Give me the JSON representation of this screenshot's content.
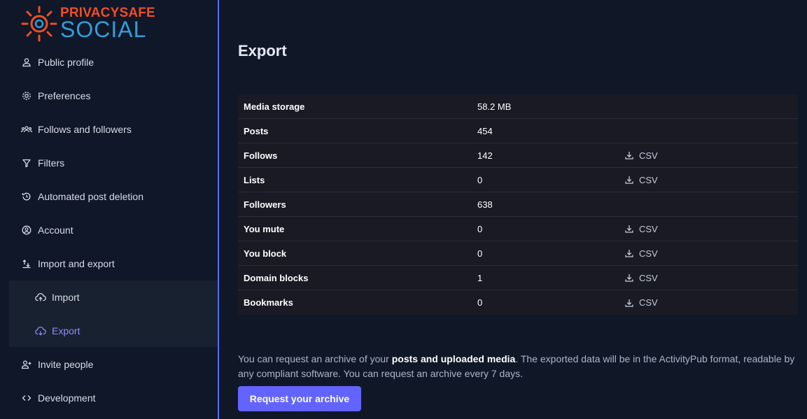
{
  "brand": {
    "line1": "PRIVACYSAFE",
    "line2": "SOCIAL"
  },
  "nav": {
    "items": [
      {
        "label": "Public profile",
        "icon": "user-icon"
      },
      {
        "label": "Preferences",
        "icon": "gear-icon"
      },
      {
        "label": "Follows and followers",
        "icon": "users-icon"
      },
      {
        "label": "Filters",
        "icon": "filter-icon"
      },
      {
        "label": "Automated post deletion",
        "icon": "history-icon"
      },
      {
        "label": "Account",
        "icon": "account-circle-icon"
      },
      {
        "label": "Import and export",
        "icon": "import-export-icon"
      },
      {
        "label": "Invite people",
        "icon": "invite-user-icon"
      },
      {
        "label": "Development",
        "icon": "code-icon"
      }
    ],
    "sub_items": [
      {
        "label": "Import",
        "icon": "cloud-upload-icon"
      },
      {
        "label": "Export",
        "icon": "cloud-download-icon",
        "active": true
      }
    ]
  },
  "page": {
    "title": "Export"
  },
  "export_table": {
    "csv_label": "CSV",
    "rows": [
      {
        "label": "Media storage",
        "value": "58.2 MB",
        "csv": false
      },
      {
        "label": "Posts",
        "value": "454",
        "csv": false
      },
      {
        "label": "Follows",
        "value": "142",
        "csv": true
      },
      {
        "label": "Lists",
        "value": "0",
        "csv": true
      },
      {
        "label": "Followers",
        "value": "638",
        "csv": false
      },
      {
        "label": "You mute",
        "value": "0",
        "csv": true
      },
      {
        "label": "You block",
        "value": "0",
        "csv": true
      },
      {
        "label": "Domain blocks",
        "value": "1",
        "csv": true
      },
      {
        "label": "Bookmarks",
        "value": "0",
        "csv": true
      }
    ]
  },
  "archive_note": {
    "part1": "You can request an archive of your ",
    "emphasis": "posts and uploaded media",
    "part2": ". The exported data will be in the ActivityPub format, readable by any compliant software. You can request an archive every 7 days."
  },
  "request_button": {
    "label": "Request your archive"
  },
  "colors": {
    "accent": "#6364ff",
    "active_nav": "#8c8dff",
    "sidebar_border": "#4f6ef7",
    "background": "#101828"
  }
}
